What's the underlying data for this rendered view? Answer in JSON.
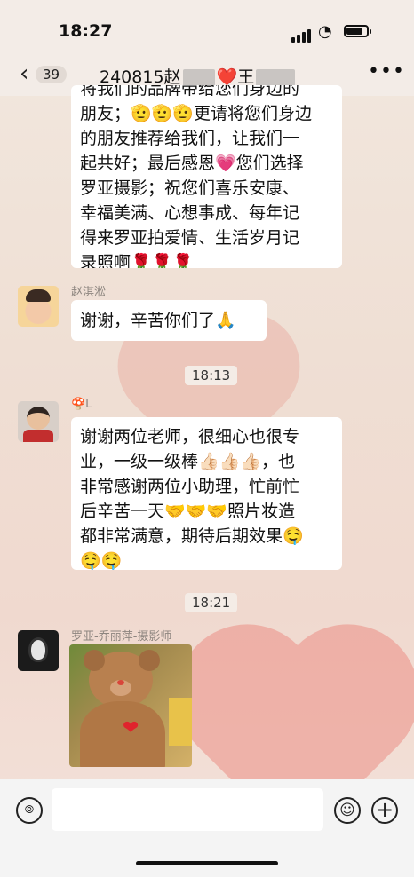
{
  "status_bar": {
    "time": "18:27"
  },
  "nav": {
    "back_count": "39",
    "title_prefix": "240815赵",
    "title_heart": "❤️",
    "title_suffix": "王"
  },
  "messages": [
    {
      "sender": "",
      "lines": [
        "将我们的品牌带给您们身边的",
        "朋友；🫡🫡🫡更请将您们身边",
        "的朋友推荐给我们，让我们一",
        "起共好；最后感恩💗您们选择",
        "罗亚摄影；祝您们喜乐安康、",
        "幸福美满、心想事成、每年记",
        "得来罗亚拍爱情、生活岁月记",
        "录照啊🌹🌹🌹"
      ]
    },
    {
      "sender": "赵淇淞",
      "lines": [
        "谢谢，辛苦你们了🙏"
      ]
    },
    {
      "timestamp": "18:13"
    },
    {
      "sender": "🍄L",
      "lines": [
        "谢谢两位老师，很细心也很专",
        "业，一级一级棒👍🏻👍🏻👍🏻，也",
        "非常感谢两位小助理，忙前忙",
        "后辛苦一天🤝🤝🤝照片妆造",
        "都非常满意，期待后期效果🤤",
        "🤤🤤"
      ]
    },
    {
      "timestamp": "18:21"
    },
    {
      "sender": "罗亚-乔丽萍-摄影师",
      "image": "teddy-bear-photo"
    }
  ],
  "bottom_bar": {
    "voice_icon": "voice-icon",
    "emoji_icon": "smile-icon",
    "plus_icon": "plus-icon"
  }
}
